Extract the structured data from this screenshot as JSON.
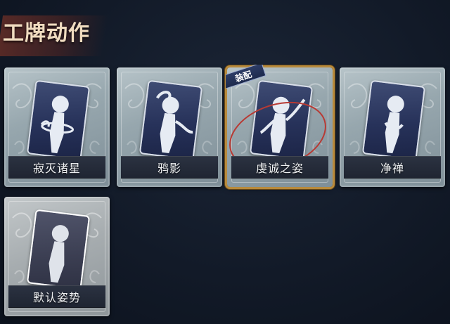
{
  "header": {
    "title": "工牌动作"
  },
  "cards": [
    {
      "label": "寂灭诸星",
      "equipped": false
    },
    {
      "label": "鸦影",
      "equipped": false
    },
    {
      "label": "虔诚之姿",
      "equipped": true,
      "badge": "装配"
    },
    {
      "label": "净禅",
      "equipped": false
    },
    {
      "label": "默认姿势",
      "equipped": false
    }
  ],
  "colors": {
    "equipped_border": "#b88a3c",
    "badge_bg": "#1d2a4d",
    "title_banner": "#7e3428"
  },
  "icons": [
    "pose-silhouette-icon",
    "swirl-ornament-icon"
  ]
}
